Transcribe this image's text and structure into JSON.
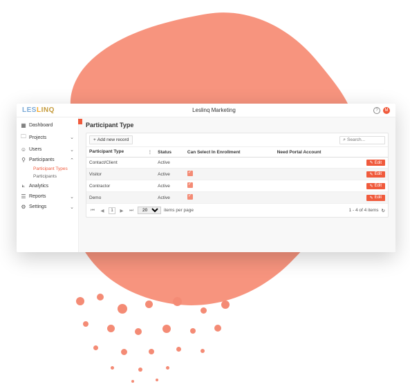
{
  "header": {
    "logo_text": "LESLINQ",
    "title": "Leslinq Marketing",
    "avatar_initial": "M"
  },
  "sidebar": {
    "items": [
      {
        "icon": "dashboard",
        "label": "Dashboard",
        "expandable": false
      },
      {
        "icon": "folder",
        "label": "Projects",
        "expandable": true,
        "expanded": false
      },
      {
        "icon": "user",
        "label": "Users",
        "expandable": true,
        "expanded": false
      },
      {
        "icon": "participants",
        "label": "Participants",
        "expandable": true,
        "expanded": true,
        "children": [
          {
            "label": "Participant Types",
            "active": true
          },
          {
            "label": "Participants",
            "active": false
          }
        ]
      },
      {
        "icon": "chart",
        "label": "Analytics",
        "expandable": false
      },
      {
        "icon": "report",
        "label": "Reports",
        "expandable": true,
        "expanded": false
      },
      {
        "icon": "gear",
        "label": "Settings",
        "expandable": true,
        "expanded": false
      }
    ]
  },
  "main": {
    "page_title": "Participant Type",
    "add_button": "Add new record",
    "search_placeholder": "Search...",
    "columns": [
      "Participant Type",
      "Status",
      "Can Select In Enrollment",
      "Need Portal Account",
      ""
    ],
    "rows": [
      {
        "name": "Contact/Client",
        "status": "Active",
        "enroll": false,
        "portal": false
      },
      {
        "name": "Visitor",
        "status": "Active",
        "enroll": true,
        "portal": false
      },
      {
        "name": "Contractor",
        "status": "Active",
        "enroll": true,
        "portal": false
      },
      {
        "name": "Demo",
        "status": "Active",
        "enroll": true,
        "portal": false
      }
    ],
    "edit_label": "Edit",
    "pager": {
      "page": "1",
      "page_size": "20",
      "per_page_label": "items per page",
      "summary": "1 - 4 of 4 items"
    }
  }
}
